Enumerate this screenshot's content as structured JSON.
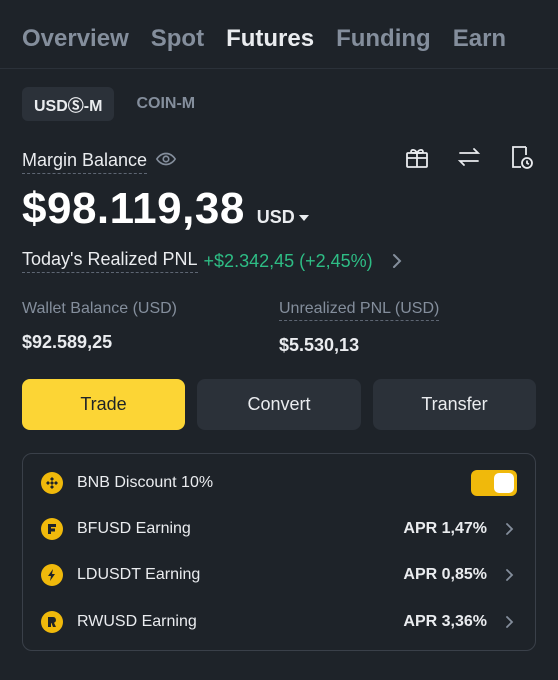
{
  "tabs": [
    {
      "label": "Overview",
      "active": false
    },
    {
      "label": "Spot",
      "active": false
    },
    {
      "label": "Futures",
      "active": true
    },
    {
      "label": "Funding",
      "active": false
    },
    {
      "label": "Earn",
      "active": false
    }
  ],
  "subtabs": [
    {
      "label": "USDⓈ-M",
      "active": true
    },
    {
      "label": "COIN-M",
      "active": false
    }
  ],
  "margin_balance": {
    "label": "Margin Balance",
    "value": "$98.119,38",
    "currency": "USD",
    "icons": [
      "eye-icon",
      "gift-icon",
      "swap-arrows-icon",
      "history-icon"
    ]
  },
  "pnl": {
    "label": "Today's Realized PNL",
    "value": "+$2.342,45 (+2,45%)",
    "color": "#2ebd85"
  },
  "wallet": {
    "wallet_label": "Wallet Balance (USD)",
    "wallet_value": "$92.589,25",
    "unrealized_label": "Unrealized PNL (USD)",
    "unrealized_value": "$5.530,13"
  },
  "actions": {
    "trade": "Trade",
    "convert": "Convert",
    "transfer": "Transfer",
    "accent": "#fcd535"
  },
  "card": {
    "bnb_label": "BNB Discount 10%",
    "bnb_enabled": true,
    "rows": [
      {
        "label": "BFUSD Earning",
        "apr": "APR 1,47%",
        "icon": "bfusd-icon"
      },
      {
        "label": "LDUSDT Earning",
        "apr": "APR 0,85%",
        "icon": "ldusdt-icon"
      },
      {
        "label": "RWUSD Earning",
        "apr": "APR 3,36%",
        "icon": "rwusd-icon"
      }
    ]
  }
}
